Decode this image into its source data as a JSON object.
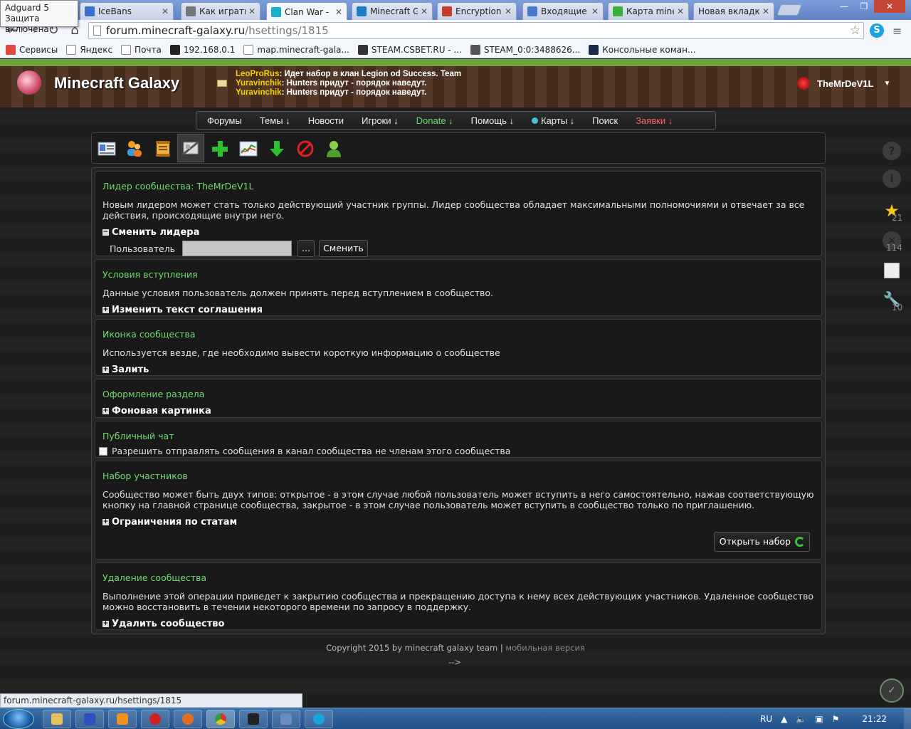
{
  "adguard": {
    "line1": "Adguard 5",
    "line2": "Защита включена"
  },
  "tabs": [
    {
      "label": "IceBans",
      "color": "#3a6fd0"
    },
    {
      "label": "Как играть",
      "color": "#777"
    },
    {
      "label": "Clan War - M",
      "color": "#1ab0c8"
    },
    {
      "label": "Minecraft Ga",
      "color": "#1a7ec8"
    },
    {
      "label": "Encryption",
      "color": "#c83a2a"
    },
    {
      "label": "Входящие -",
      "color": "#4a7ad0"
    },
    {
      "label": "Карта mine",
      "color": "#3ab03a"
    },
    {
      "label": "Новая вкладка",
      "color": "#ffffff"
    }
  ],
  "omnibox": {
    "host": "forum.minecraft-galaxy.ru",
    "path": "/hsettings/1815"
  },
  "bookmarks": [
    {
      "label": "Сервисы",
      "color": "#e14a3a"
    },
    {
      "label": "Яндекс",
      "color": "#ffffff"
    },
    {
      "label": "Почта",
      "color": "#ffffff"
    },
    {
      "label": "192.168.0.1",
      "color": "#222222"
    },
    {
      "label": "map.minecraft-gala...",
      "color": "#ffffff"
    },
    {
      "label": "STEAM.CSBET.RU - ...",
      "color": "#333333"
    },
    {
      "label": "STEAM_0:0:3488626...",
      "color": "#555555"
    },
    {
      "label": "Консольные коман...",
      "color": "#1a2a4a"
    }
  ],
  "site": {
    "logo": "Minecraft Galaxy",
    "shouts": [
      {
        "nick": "LeoProRus",
        "text": ": Идет набор в клан Legion od Success. Team"
      },
      {
        "nick": "Yuravinchik",
        "text": ": Hunters придут - порядок наведут."
      },
      {
        "nick": "Yuravinchik",
        "text": ": Hunters придут - порядок наведут."
      }
    ],
    "username": "TheMrDeV1L",
    "user_arrow": "▼"
  },
  "nav": [
    {
      "label": "Форумы"
    },
    {
      "label": "Темы ↓"
    },
    {
      "label": "Новости"
    },
    {
      "label": "Игроки ↓"
    },
    {
      "label": "Donate ↓"
    },
    {
      "label": "Помощь ↓"
    },
    {
      "label": "Карты ↓"
    },
    {
      "label": "Поиск"
    },
    {
      "label": "Заявки ↓"
    }
  ],
  "sections": {
    "leader": {
      "title": "Лидер сообщества: TheMrDeV1L",
      "text": "Новым лидером может стать только действующий участник группы. Лидер сообщества обладает максимальными полномочиями и отвечает за все действия, происходящие внутри него.",
      "toggle": "Сменить лидера",
      "toggle_box": "−",
      "user_label": "Пользователь",
      "browse": "...",
      "submit": "Сменить"
    },
    "terms": {
      "title": "Условия вступления",
      "text": "Данные условия пользователь должен принять перед вступлением в сообщество.",
      "toggle": "Изменить текст соглашения",
      "toggle_box": "+"
    },
    "icon": {
      "title": "Иконка сообщества",
      "text": "Используется везде, где необходимо вывести короткую информацию о сообществе",
      "toggle": "Залить",
      "toggle_box": "+"
    },
    "design": {
      "title": "Оформление раздела",
      "toggle": "Фоновая картинка",
      "toggle_box": "+"
    },
    "chat": {
      "title": "Публичный чат",
      "checkbox": "Разрешить отправлять сообщения в канал сообщества не членам этого сообщества",
      "checked": false
    },
    "recruit": {
      "title": "Набор участников",
      "text": "Сообщество может быть двух типов: открытое - в этом случае любой пользователь может вступить в него самостоятельно, нажав соответствующую кнопку на главной странице сообщества, закрытое - в этом случае пользователь может вступить в сообщество только по приглашению.",
      "toggle": "Ограничения по статам",
      "toggle_box": "+",
      "open_button": "Открыть набор"
    },
    "delete": {
      "title": "Удаление сообщества",
      "text": "Выполнение этой операции приведет к закрытию сообщества и прекращению доступа к нему всех действующих участников. Удаленное сообщество можно восстановить в течении некоторого времени по запросу в поддержку.",
      "toggle": "Удалить сообщество",
      "toggle_box": "+"
    }
  },
  "footer": {
    "copyright": "Copyright 2015 by minecraft galaxy team",
    "sep": "|",
    "mobile": "мобильная версия",
    "leftover": "-->"
  },
  "right_widgets": {
    "star_count": "21",
    "x_count": "114",
    "wrench_count": "10"
  },
  "statusbar": "forum.minecraft-galaxy.ru/hsettings/1815",
  "taskbar": {
    "lang": "RU",
    "time": "21:22"
  },
  "colors": {
    "accent_green": "#6fdc6f",
    "nav_donate": "#6cde6c",
    "nav_requests": "#ff6060",
    "shout_nick": "#f5d000"
  }
}
